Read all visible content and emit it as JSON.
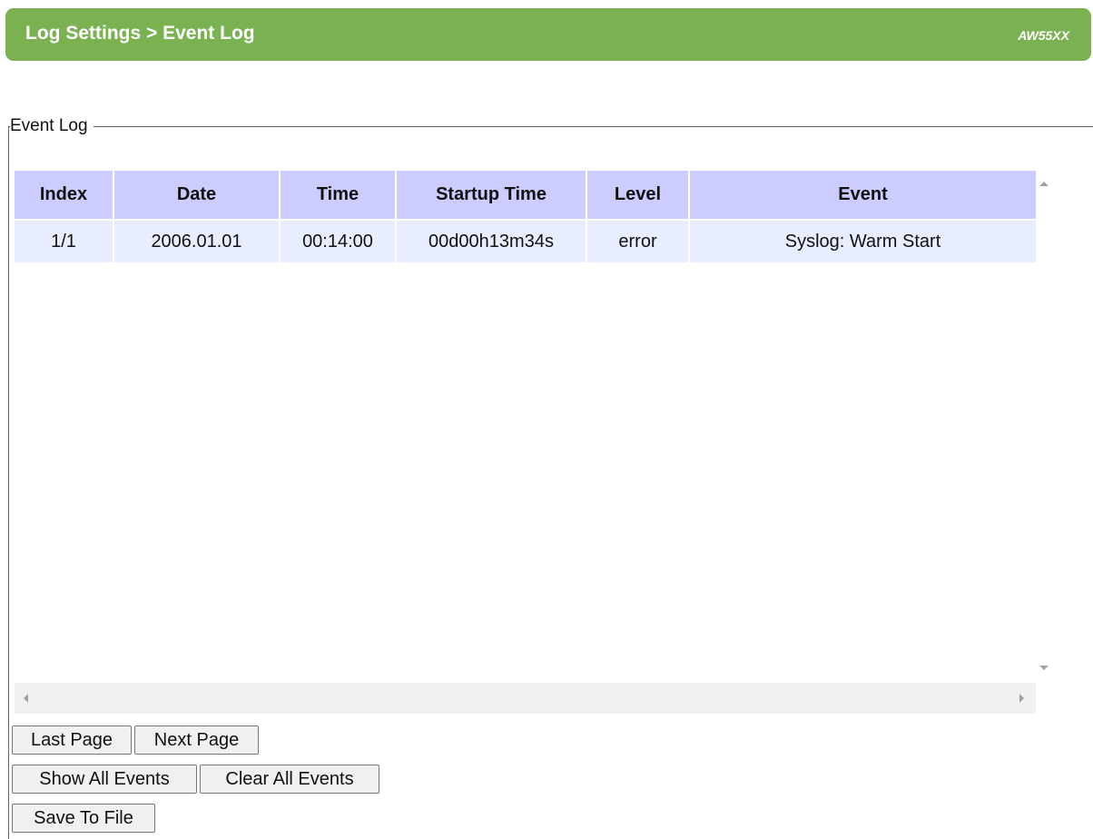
{
  "header": {
    "title": "Log Settings > Event Log",
    "model": "AW55XX",
    "background_color": "#7ab252"
  },
  "section": {
    "legend": "Event Log"
  },
  "table": {
    "header_color": "#ccccff",
    "row_color": "#e8eeff",
    "columns": [
      "Index",
      "Date",
      "Time",
      "Startup Time",
      "Level",
      "Event"
    ],
    "rows": [
      {
        "index": "1/1",
        "date": "2006.01.01",
        "time": "00:14:00",
        "startup_time": "00d00h13m34s",
        "level": "error",
        "event": "Syslog: Warm Start"
      }
    ]
  },
  "buttons": {
    "last_page": "Last Page",
    "next_page": "Next Page",
    "show_all_events": "Show All Events",
    "clear_all_events": "Clear All Events",
    "save_to_file": "Save To File"
  }
}
